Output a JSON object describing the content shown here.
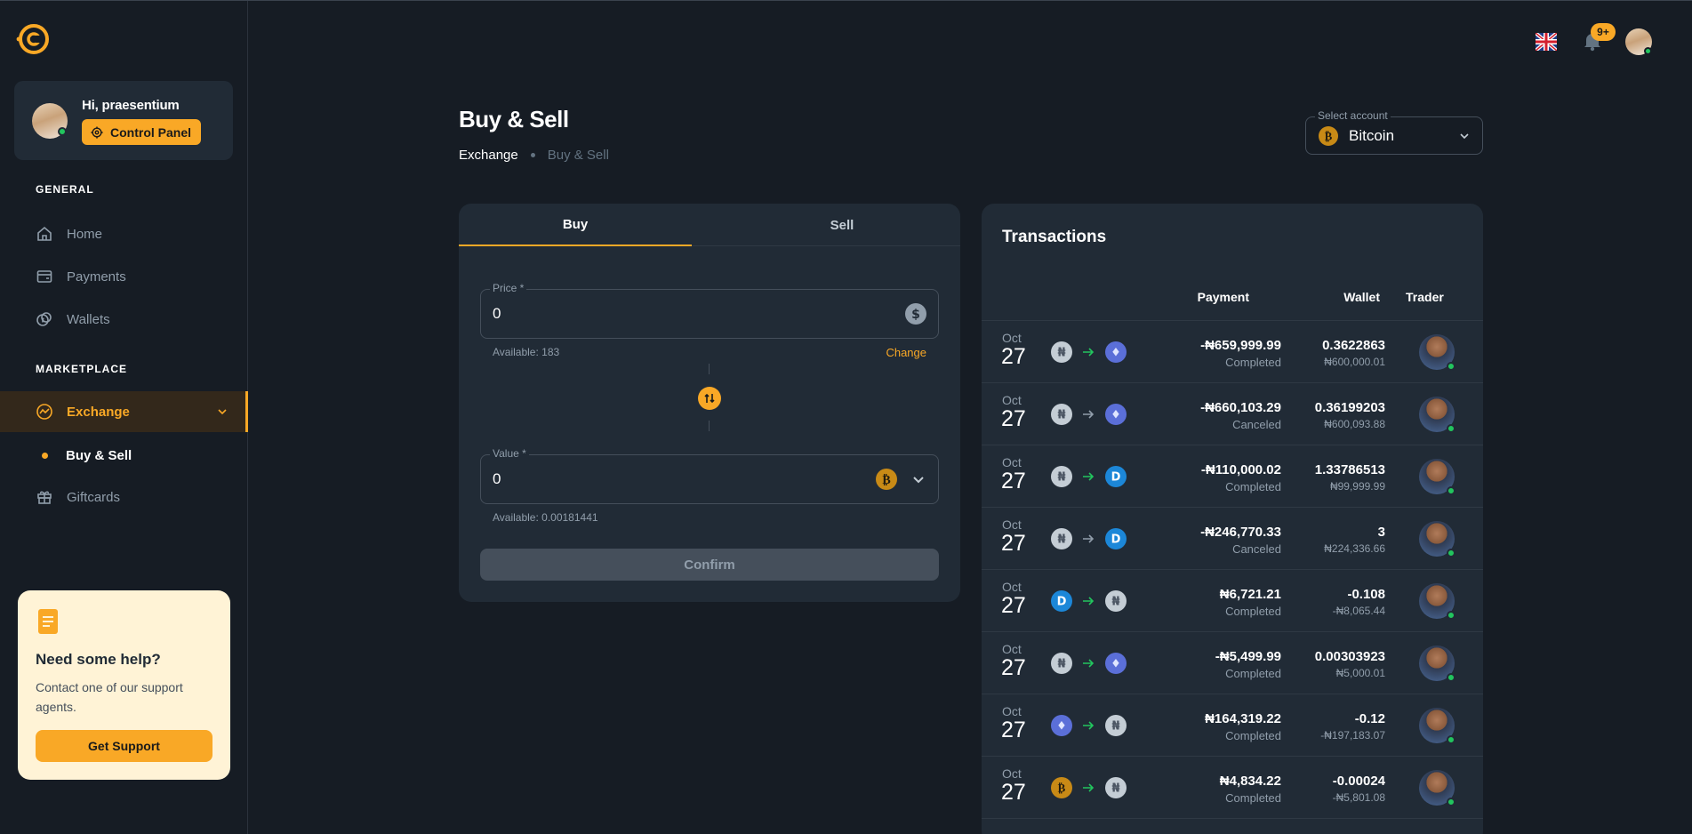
{
  "user": {
    "greeting": "Hi,",
    "name": "praesentium",
    "control_panel": "Control Panel"
  },
  "nav": {
    "general_label": "GENERAL",
    "home": "Home",
    "payments": "Payments",
    "wallets": "Wallets",
    "marketplace_label": "MARKETPLACE",
    "exchange": "Exchange",
    "buy_sell": "Buy & Sell",
    "giftcards": "Giftcards"
  },
  "help": {
    "title": "Need some help?",
    "text": "Contact one of our support agents.",
    "button": "Get Support"
  },
  "header": {
    "notification_count": "9+",
    "language_icon": "uk-flag-icon"
  },
  "page": {
    "title": "Buy & Sell",
    "breadcrumb": [
      "Exchange",
      "Buy & Sell"
    ]
  },
  "account_select": {
    "label": "Select account",
    "value": "Bitcoin"
  },
  "trade": {
    "tabs": [
      "Buy",
      "Sell"
    ],
    "price_label": "Price *",
    "price_value": "0",
    "price_available": "Available: 183",
    "change": "Change",
    "value_label": "Value *",
    "value_value": "0",
    "value_available": "Available: 0.00181441",
    "confirm": "Confirm"
  },
  "transactions": {
    "title": "Transactions",
    "columns": [
      "Payment",
      "Wallet",
      "Trader"
    ],
    "rows": [
      {
        "month": "Oct",
        "day": "27",
        "from": "naira",
        "to": "eth",
        "arrow": "green",
        "payment": "-₦659,999.99",
        "status": "Completed",
        "wallet": "0.3622863",
        "wallet_sub": "₦600,000.01"
      },
      {
        "month": "Oct",
        "day": "27",
        "from": "naira",
        "to": "eth",
        "arrow": "gray",
        "payment": "-₦660,103.29",
        "status": "Canceled",
        "wallet": "0.36199203",
        "wallet_sub": "₦600,093.88"
      },
      {
        "month": "Oct",
        "day": "27",
        "from": "naira",
        "to": "dash",
        "arrow": "green",
        "payment": "-₦110,000.02",
        "status": "Completed",
        "wallet": "1.33786513",
        "wallet_sub": "₦99,999.99"
      },
      {
        "month": "Oct",
        "day": "27",
        "from": "naira",
        "to": "dash",
        "arrow": "gray",
        "payment": "-₦246,770.33",
        "status": "Canceled",
        "wallet": "3",
        "wallet_sub": "₦224,336.66"
      },
      {
        "month": "Oct",
        "day": "27",
        "from": "dash",
        "to": "naira",
        "arrow": "green",
        "payment": "₦6,721.21",
        "status": "Completed",
        "wallet": "-0.108",
        "wallet_sub": "-₦8,065.44"
      },
      {
        "month": "Oct",
        "day": "27",
        "from": "naira",
        "to": "eth",
        "arrow": "green",
        "payment": "-₦5,499.99",
        "status": "Completed",
        "wallet": "0.00303923",
        "wallet_sub": "₦5,000.01"
      },
      {
        "month": "Oct",
        "day": "27",
        "from": "eth",
        "to": "naira",
        "arrow": "green",
        "payment": "₦164,319.22",
        "status": "Completed",
        "wallet": "-0.12",
        "wallet_sub": "-₦197,183.07"
      },
      {
        "month": "Oct",
        "day": "27",
        "from": "btc",
        "to": "naira",
        "arrow": "green",
        "payment": "₦4,834.22",
        "status": "Completed",
        "wallet": "-0.00024",
        "wallet_sub": "-₦5,801.08"
      }
    ]
  },
  "colors": {
    "accent": "#f9a826",
    "background": "#161c24",
    "card": "#212b36",
    "success": "#22c55e"
  }
}
